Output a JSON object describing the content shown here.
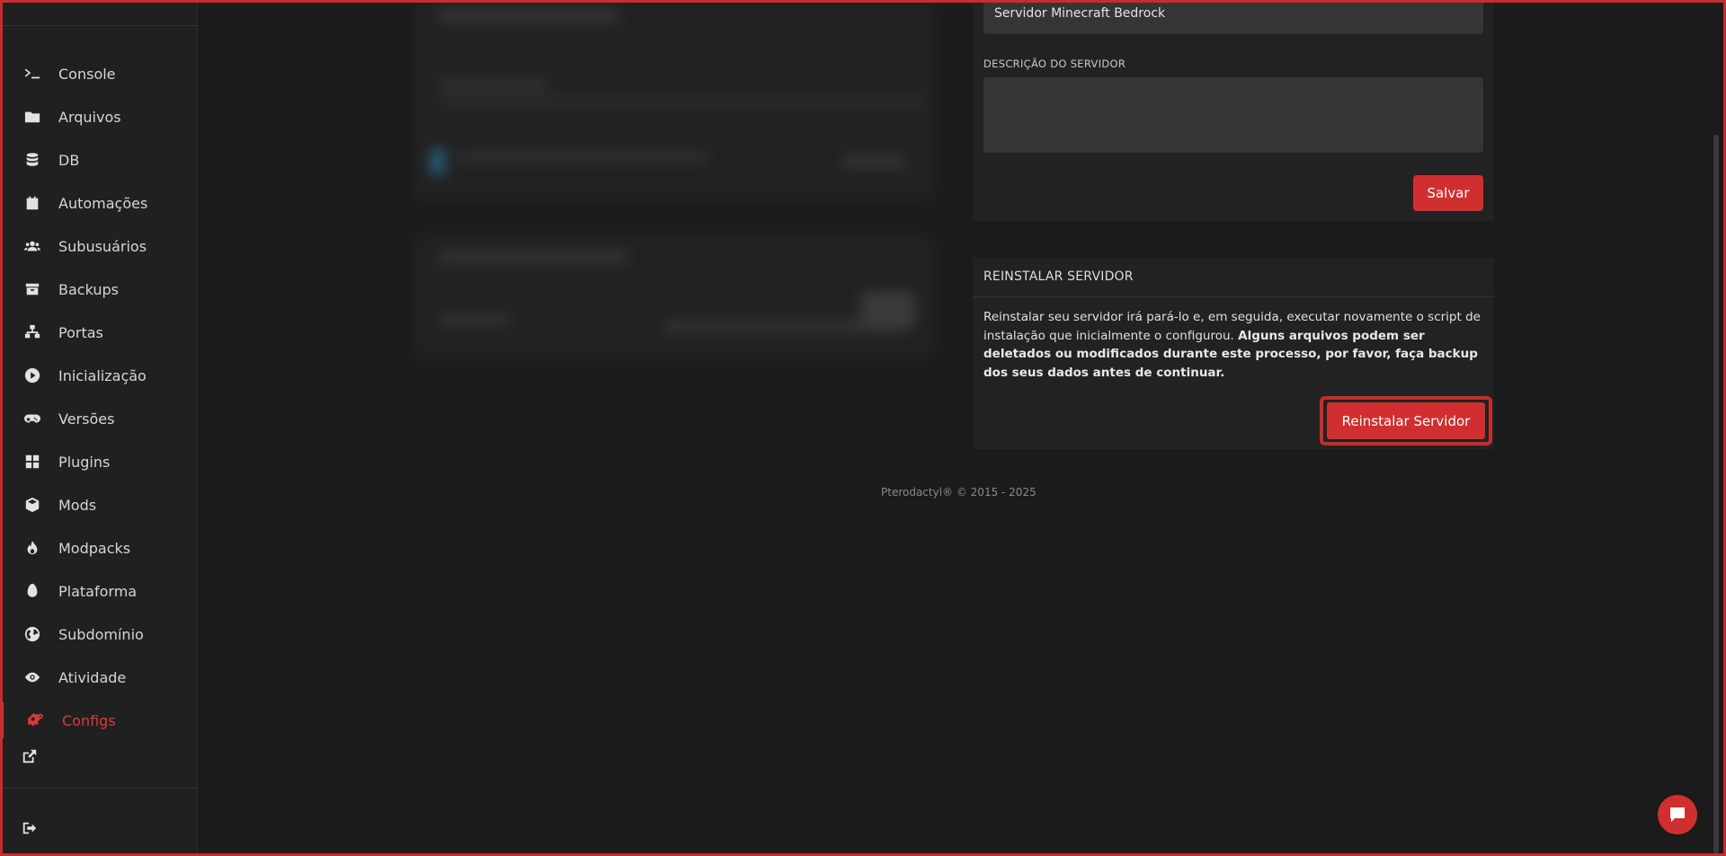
{
  "sidebar": {
    "items": [
      {
        "label": "Console",
        "icon": "terminal-icon"
      },
      {
        "label": "Arquivos",
        "icon": "folder-icon"
      },
      {
        "label": "DB",
        "icon": "database-icon"
      },
      {
        "label": "Automações",
        "icon": "calendar-icon"
      },
      {
        "label": "Subusuários",
        "icon": "users-icon"
      },
      {
        "label": "Backups",
        "icon": "archive-icon"
      },
      {
        "label": "Portas",
        "icon": "network-icon"
      },
      {
        "label": "Inicialização",
        "icon": "play-circle-icon"
      },
      {
        "label": "Versões",
        "icon": "gamepad-icon"
      },
      {
        "label": "Plugins",
        "icon": "grid-icon"
      },
      {
        "label": "Mods",
        "icon": "cube-icon"
      },
      {
        "label": "Modpacks",
        "icon": "fire-icon"
      },
      {
        "label": "Plataforma",
        "icon": "egg-icon"
      },
      {
        "label": "Subdomínio",
        "icon": "globe-icon"
      },
      {
        "label": "Atividade",
        "icon": "eye-icon"
      },
      {
        "label": "Configs",
        "icon": "cogs-icon",
        "active": true
      }
    ],
    "external_icon": "external-link-icon",
    "logout_icon": "sign-out-icon"
  },
  "settings": {
    "server_name_value": "Servidor Minecraft Bedrock",
    "description_label": "DESCRIÇÃO DO SERVIDOR",
    "description_value": "",
    "save_label": "Salvar"
  },
  "reinstall": {
    "title": "REINSTALAR SERVIDOR",
    "text_normal": "Reinstalar seu servidor irá pará-lo e, em seguida, executar novamente o script de instalação que inicialmente o configurou. ",
    "text_bold": "Alguns arquivos podem ser deletados ou modificados durante este processo, por favor, faça backup dos seus dados antes de continuar.",
    "button_label": "Reinstalar Servidor"
  },
  "footer": "Pterodactyl® © 2015 - 2025",
  "colors": {
    "accent": "#d12f2f",
    "background": "#1b1b1b",
    "card": "#222222",
    "input": "#353535"
  }
}
